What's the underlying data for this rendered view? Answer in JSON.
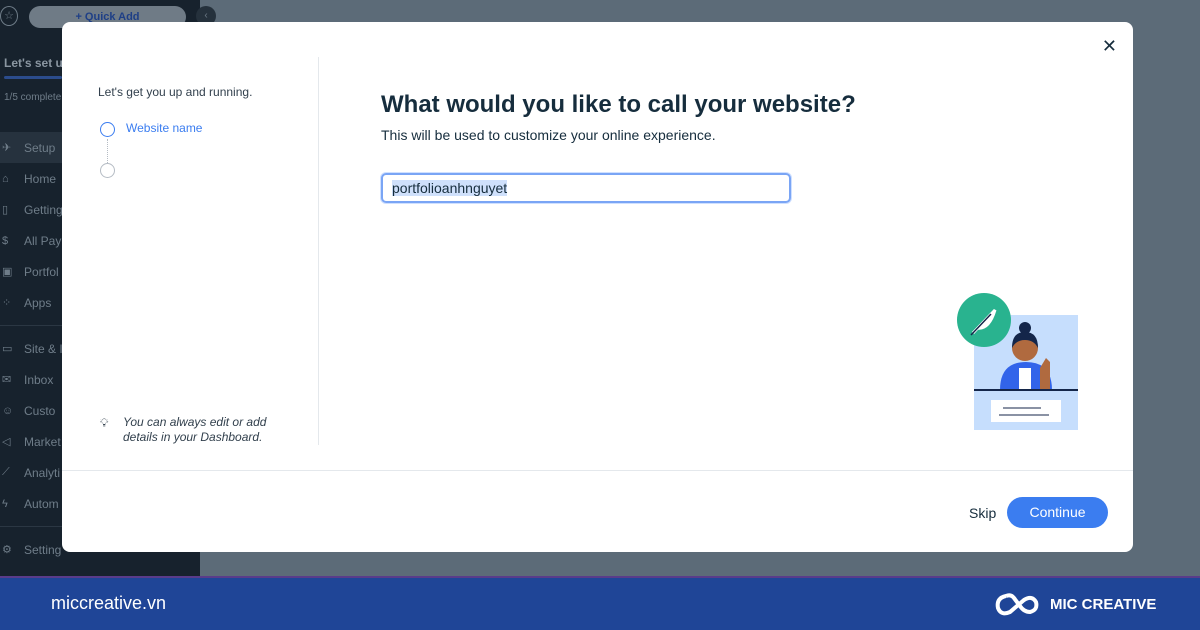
{
  "sidebar": {
    "quick_add": "+ Quick Add",
    "setup_title": "Let's set u",
    "progress_fraction": 0.2,
    "progress_text": "1/5 complete",
    "items": [
      {
        "label": "Setup",
        "icon": "rocket-icon",
        "glyph": "✈"
      },
      {
        "label": "Home",
        "icon": "home-icon",
        "glyph": "⌂"
      },
      {
        "label": "Getting",
        "icon": "document-icon",
        "glyph": "▯"
      },
      {
        "label": "All Pay",
        "icon": "dollar-icon",
        "glyph": "$"
      },
      {
        "label": "Portfol",
        "icon": "portfolio-icon",
        "glyph": "▣"
      },
      {
        "label": "Apps",
        "icon": "apps-icon",
        "glyph": "⁘"
      },
      {
        "label": "Site & I",
        "icon": "site-icon",
        "glyph": "▭"
      },
      {
        "label": "Inbox",
        "icon": "inbox-icon",
        "glyph": "✉"
      },
      {
        "label": "Custo",
        "icon": "customers-icon",
        "glyph": "☺"
      },
      {
        "label": "Market",
        "icon": "megaphone-icon",
        "glyph": "◁"
      },
      {
        "label": "Analyti",
        "icon": "analytics-icon",
        "glyph": "⟋"
      },
      {
        "label": "Autom",
        "icon": "automation-icon",
        "glyph": "ϟ"
      },
      {
        "label": "Setting",
        "icon": "gear-icon",
        "glyph": "⚙"
      }
    ]
  },
  "modal": {
    "intro": "Let's get you up and running.",
    "steps": [
      {
        "label": "Website name",
        "active": true
      },
      {
        "label": "",
        "active": false
      }
    ],
    "tip": "You can always edit or add details in your Dashboard.",
    "title": "What would you like to call your website?",
    "subtitle": "This will be used to customize your online experience.",
    "input_value": "portfolioanhnguyet",
    "skip": "Skip",
    "continue": "Continue",
    "accent": "#3b7df0"
  },
  "banner": {
    "site": "miccreative.vn",
    "brand": "MIC CREATIVE",
    "color": "#1f4597"
  }
}
